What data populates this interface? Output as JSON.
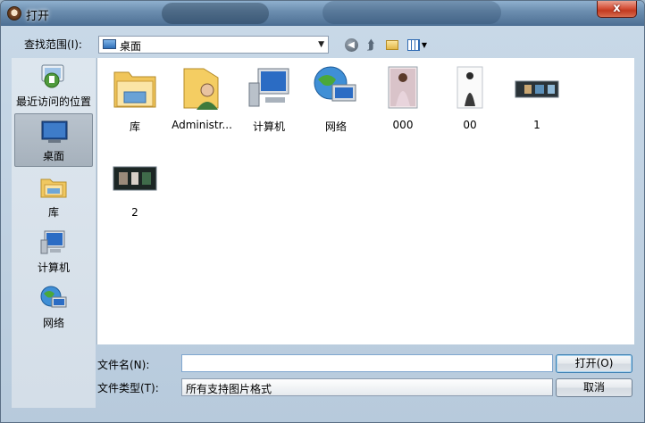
{
  "window": {
    "title": "打开",
    "close_label": "x"
  },
  "toolbar": {
    "lookin_label": "查找范围(I):",
    "lookin_value": "桌面",
    "icons": [
      "back-icon",
      "up-folder-icon",
      "new-folder-icon",
      "view-menu-icon"
    ]
  },
  "places": [
    {
      "label": "最近访问的位置",
      "icon": "recent-places-icon",
      "selected": false
    },
    {
      "label": "桌面",
      "icon": "desktop-icon",
      "selected": true
    },
    {
      "label": "库",
      "icon": "library-icon",
      "selected": false
    },
    {
      "label": "计算机",
      "icon": "computer-icon",
      "selected": false
    },
    {
      "label": "网络",
      "icon": "network-icon",
      "selected": false
    }
  ],
  "files": [
    {
      "label": "库",
      "icon": "library-folder-icon"
    },
    {
      "label": "Administr...",
      "icon": "user-folder-icon"
    },
    {
      "label": "计算机",
      "icon": "computer-icon"
    },
    {
      "label": "网络",
      "icon": "network-icon"
    },
    {
      "label": "000",
      "icon": "image-thumbnail"
    },
    {
      "label": "00",
      "icon": "image-thumbnail"
    },
    {
      "label": "1",
      "icon": "image-thumbnail"
    },
    {
      "label": "2",
      "icon": "image-thumbnail"
    }
  ],
  "footer": {
    "filename_label": "文件名(N):",
    "filename_value": "",
    "filetype_label": "文件类型(T):",
    "filetype_value": "所有支持图片格式",
    "open_label": "打开(O)",
    "cancel_label": "取消"
  },
  "colors": {
    "title_bar": "#6d8fb0",
    "close_button": "#c23a20",
    "selection": "#a6b1bc",
    "accent": "#2f6fb8"
  }
}
